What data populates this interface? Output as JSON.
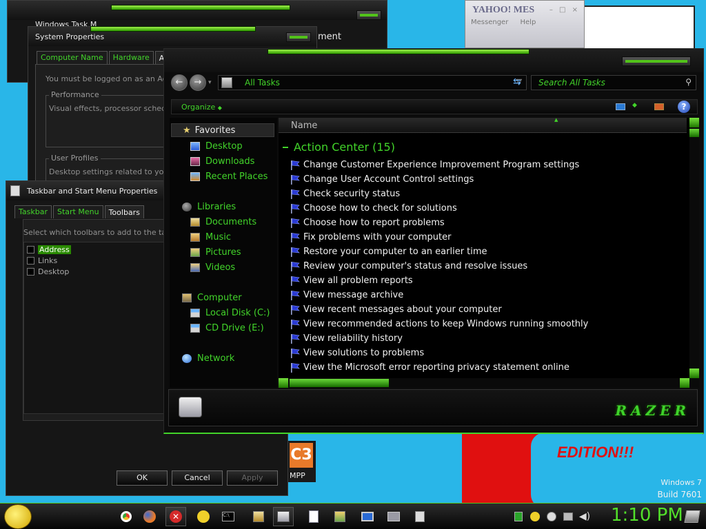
{
  "desktop": {
    "watermark_line1": "Windows 7",
    "watermark_line2": "Build 7601",
    "wallpaper_text": "EDITION!!!",
    "mpp_label": "MPP",
    "mpp_icon_text": "C3"
  },
  "yahoo": {
    "title": "YAHOO! MES",
    "menu": [
      "Messenger",
      "Help"
    ]
  },
  "task_manager": {
    "title": "Windows Task M",
    "partial_text": "ment"
  },
  "system_properties": {
    "title": "System Properties",
    "tabs": [
      "Computer Name",
      "Hardware",
      "Advanced"
    ],
    "logged_on_text": "You must be logged on as an Admi",
    "performance_label": "Performance",
    "performance_text": "Visual effects, processor schedulin",
    "user_profiles_label": "User Profiles",
    "user_profiles_text": "Desktop settings related to your lo"
  },
  "taskbar_props": {
    "title": "Taskbar and Start Menu Properties",
    "tabs": [
      "Taskbar",
      "Start Menu",
      "Toolbars"
    ],
    "instruction": "Select which toolbars to add to the taskba",
    "toolbars": [
      "Address",
      "Links",
      "Desktop"
    ],
    "ok": "OK",
    "cancel": "Cancel",
    "apply": "Apply"
  },
  "explorer": {
    "address_text": "All Tasks",
    "search_placeholder": "Search All Tasks",
    "organize_label": "Organize",
    "column_name": "Name",
    "favorites_header": "Favorites",
    "favorites": [
      "Desktop",
      "Downloads",
      "Recent Places"
    ],
    "libraries_header": "Libraries",
    "libraries": [
      "Documents",
      "Music",
      "Pictures",
      "Videos"
    ],
    "computer_header": "Computer",
    "drives": [
      "Local Disk (C:)",
      "CD Drive (E:)"
    ],
    "network_header": "Network",
    "group_title": "Action Center (15)",
    "tasks": [
      "Change Customer Experience Improvement Program settings",
      "Change User Account Control settings",
      "Check security status",
      "Choose how to check for solutions",
      "Choose how to report problems",
      "Fix problems with your computer",
      "Restore your computer to an earlier time",
      "Review your computer's status and resolve issues",
      "View all problem reports",
      "View message archive",
      "View recent messages about your computer",
      "View recommended actions to keep Windows running smoothly",
      "View reliability history",
      "View solutions to problems",
      "View the Microsoft error reporting privacy statement online"
    ],
    "brand_logo": "RAZER"
  },
  "taskbar": {
    "clock": "1:10 PM"
  },
  "colors": {
    "accent": "#42d42a",
    "background": "#29b6e8",
    "window": "#0c0c0c"
  }
}
